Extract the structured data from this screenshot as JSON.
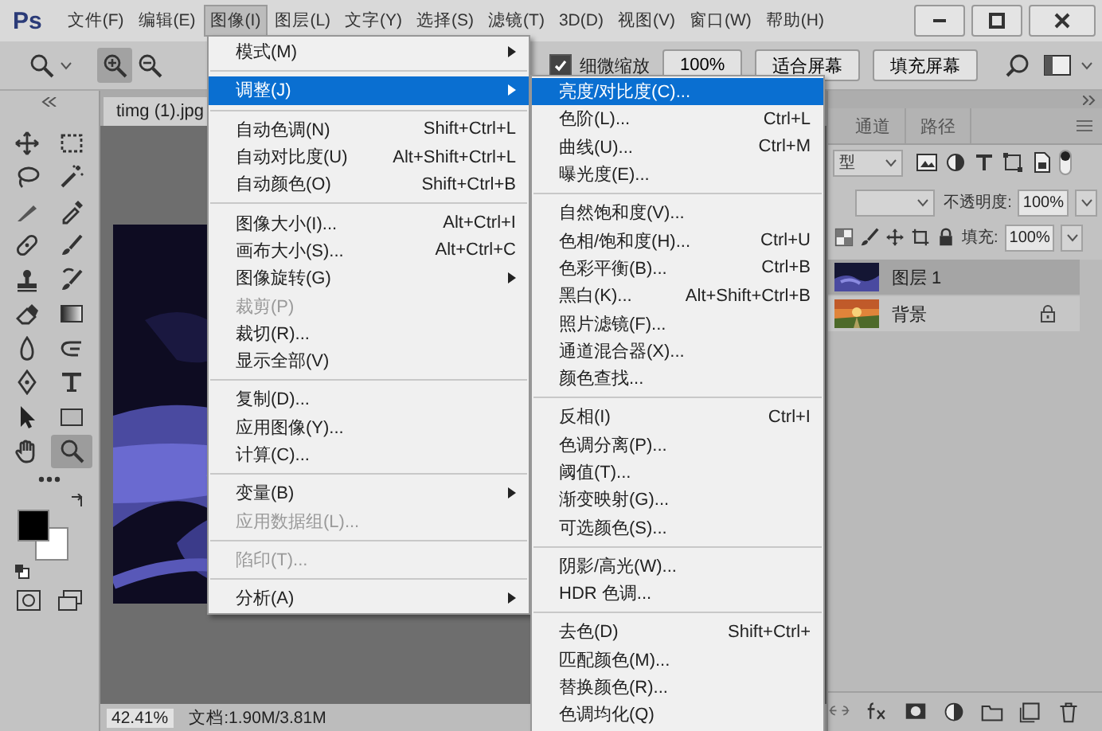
{
  "app": {
    "logo": "Ps"
  },
  "menubar": [
    {
      "label": "文件(F)",
      "selected": false
    },
    {
      "label": "编辑(E)",
      "selected": false
    },
    {
      "label": "图像(I)",
      "selected": true
    },
    {
      "label": "图层(L)",
      "selected": false
    },
    {
      "label": "文字(Y)",
      "selected": false
    },
    {
      "label": "选择(S)",
      "selected": false
    },
    {
      "label": "滤镜(T)",
      "selected": false
    },
    {
      "label": "3D(D)",
      "selected": false
    },
    {
      "label": "视图(V)",
      "selected": false
    },
    {
      "label": "窗口(W)",
      "selected": false
    },
    {
      "label": "帮助(H)",
      "selected": false
    }
  ],
  "options_bar": {
    "zoom_modes": [
      {
        "kind": "zoom-in",
        "selected": true
      },
      {
        "kind": "zoom-out",
        "selected": false
      }
    ],
    "fine_zoom": {
      "label": "细微缩放",
      "checked": true
    },
    "buttons": [
      "100%",
      "适合屏幕",
      "填充屏幕"
    ]
  },
  "tools": [
    {
      "kind": "move",
      "selected": false
    },
    {
      "kind": "marquee",
      "selected": false
    },
    {
      "kind": "lasso",
      "selected": false
    },
    {
      "kind": "wand",
      "selected": false
    },
    {
      "kind": "crop",
      "selected": false
    },
    {
      "kind": "eyedropper",
      "selected": false
    },
    {
      "kind": "healing",
      "selected": false
    },
    {
      "kind": "brush",
      "selected": false
    },
    {
      "kind": "stamp",
      "selected": false
    },
    {
      "kind": "history",
      "selected": false
    },
    {
      "kind": "eraser",
      "selected": false
    },
    {
      "kind": "gradient",
      "selected": false
    },
    {
      "kind": "blur",
      "selected": false
    },
    {
      "kind": "dodge",
      "selected": false
    },
    {
      "kind": "pen",
      "selected": false
    },
    {
      "kind": "type",
      "selected": false
    },
    {
      "kind": "select",
      "selected": false
    },
    {
      "kind": "rect",
      "selected": false
    },
    {
      "kind": "hand",
      "selected": false
    },
    {
      "kind": "zoom",
      "selected": true
    }
  ],
  "document": {
    "tab": "timg (1).jpg",
    "zoom": "42.41%",
    "info": "文档:1.90M/3.81M"
  },
  "image_menu": [
    {
      "kind": "item",
      "label": "模式(M)",
      "submenu": true,
      "disabled": false,
      "selected": false
    },
    {
      "kind": "separator"
    },
    {
      "kind": "item",
      "label": "调整(J)",
      "submenu": true,
      "disabled": false,
      "selected": true
    },
    {
      "kind": "separator"
    },
    {
      "kind": "item",
      "label": "自动色调(N)",
      "shortcut": "Shift+Ctrl+L",
      "disabled": false,
      "selected": false
    },
    {
      "kind": "item",
      "label": "自动对比度(U)",
      "shortcut": "Alt+Shift+Ctrl+L",
      "disabled": false,
      "selected": false
    },
    {
      "kind": "item",
      "label": "自动颜色(O)",
      "shortcut": "Shift+Ctrl+B",
      "disabled": false,
      "selected": false
    },
    {
      "kind": "separator"
    },
    {
      "kind": "item",
      "label": "图像大小(I)...",
      "shortcut": "Alt+Ctrl+I",
      "disabled": false,
      "selected": false
    },
    {
      "kind": "item",
      "label": "画布大小(S)...",
      "shortcut": "Alt+Ctrl+C",
      "disabled": false,
      "selected": false
    },
    {
      "kind": "item",
      "label": "图像旋转(G)",
      "submenu": true,
      "disabled": false,
      "selected": false
    },
    {
      "kind": "item",
      "label": "裁剪(P)",
      "disabled": true,
      "selected": false
    },
    {
      "kind": "item",
      "label": "裁切(R)...",
      "disabled": false,
      "selected": false
    },
    {
      "kind": "item",
      "label": "显示全部(V)",
      "disabled": false,
      "selected": false
    },
    {
      "kind": "separator"
    },
    {
      "kind": "item",
      "label": "复制(D)...",
      "disabled": false,
      "selected": false
    },
    {
      "kind": "item",
      "label": "应用图像(Y)...",
      "disabled": false,
      "selected": false
    },
    {
      "kind": "item",
      "label": "计算(C)...",
      "disabled": false,
      "selected": false
    },
    {
      "kind": "separator"
    },
    {
      "kind": "item",
      "label": "变量(B)",
      "submenu": true,
      "disabled": false,
      "selected": false
    },
    {
      "kind": "item",
      "label": "应用数据组(L)...",
      "disabled": true,
      "selected": false
    },
    {
      "kind": "separator"
    },
    {
      "kind": "item",
      "label": "陷印(T)...",
      "disabled": true,
      "selected": false
    },
    {
      "kind": "separator"
    },
    {
      "kind": "item",
      "label": "分析(A)",
      "submenu": true,
      "disabled": false,
      "selected": false
    }
  ],
  "adjust_submenu": [
    {
      "kind": "item",
      "label": "亮度/对比度(C)...",
      "selected": true
    },
    {
      "kind": "item",
      "label": "色阶(L)...",
      "shortcut": "Ctrl+L",
      "selected": false
    },
    {
      "kind": "item",
      "label": "曲线(U)...",
      "shortcut": "Ctrl+M",
      "selected": false
    },
    {
      "kind": "item",
      "label": "曝光度(E)...",
      "selected": false
    },
    {
      "kind": "separator"
    },
    {
      "kind": "item",
      "label": "自然饱和度(V)...",
      "selected": false
    },
    {
      "kind": "item",
      "label": "色相/饱和度(H)...",
      "shortcut": "Ctrl+U",
      "selected": false
    },
    {
      "kind": "item",
      "label": "色彩平衡(B)...",
      "shortcut": "Ctrl+B",
      "selected": false
    },
    {
      "kind": "item",
      "label": "黑白(K)...",
      "shortcut": "Alt+Shift+Ctrl+B",
      "selected": false
    },
    {
      "kind": "item",
      "label": "照片滤镜(F)...",
      "selected": false
    },
    {
      "kind": "item",
      "label": "通道混合器(X)...",
      "selected": false
    },
    {
      "kind": "item",
      "label": "颜色查找...",
      "selected": false
    },
    {
      "kind": "separator"
    },
    {
      "kind": "item",
      "label": "反相(I)",
      "shortcut": "Ctrl+I",
      "selected": false
    },
    {
      "kind": "item",
      "label": "色调分离(P)...",
      "selected": false
    },
    {
      "kind": "item",
      "label": "阈值(T)...",
      "selected": false
    },
    {
      "kind": "item",
      "label": "渐变映射(G)...",
      "selected": false
    },
    {
      "kind": "item",
      "label": "可选颜色(S)...",
      "selected": false
    },
    {
      "kind": "separator"
    },
    {
      "kind": "item",
      "label": "阴影/高光(W)...",
      "selected": false
    },
    {
      "kind": "item",
      "label": "HDR 色调...",
      "selected": false
    },
    {
      "kind": "separator"
    },
    {
      "kind": "item",
      "label": "去色(D)",
      "shortcut": "Shift+Ctrl+",
      "selected": false
    },
    {
      "kind": "item",
      "label": "匹配颜色(M)...",
      "selected": false
    },
    {
      "kind": "item",
      "label": "替换颜色(R)...",
      "selected": false
    },
    {
      "kind": "item",
      "label": "色调均化(Q)",
      "selected": false
    }
  ],
  "layers_panel": {
    "tabs": [
      {
        "label": "通道",
        "selected": false
      },
      {
        "label": "路径",
        "selected": false
      }
    ],
    "filter": "型",
    "opacity_label": "不透明度:",
    "opacity": "100%",
    "fill_label": "填充:",
    "fill": "100%",
    "layers": [
      {
        "name": "图层 1",
        "selected": true,
        "locked": false,
        "kind": "night"
      },
      {
        "name": "背景",
        "selected": false,
        "locked": true,
        "kind": "sunset"
      }
    ]
  }
}
